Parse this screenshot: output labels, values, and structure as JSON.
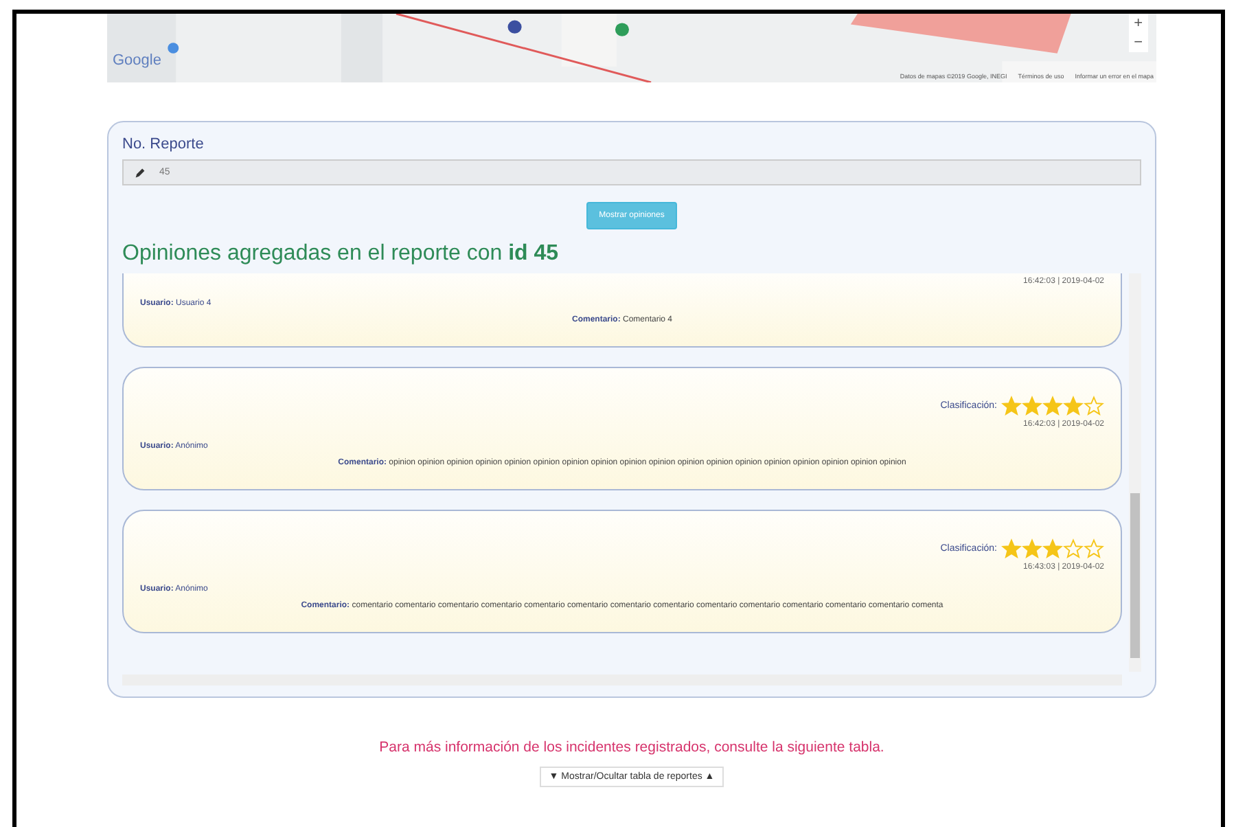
{
  "map": {
    "logo": "Google",
    "zoom_in": "+",
    "zoom_out": "−",
    "attribution": [
      "Datos de mapas ©2019 Google, INEGI",
      "Términos de uso",
      "Informar un error en el mapa"
    ]
  },
  "report": {
    "label": "No. Reporte",
    "value": "45",
    "button": "Mostrar opiniones"
  },
  "heading": "Opiniones agregadas en el reporte con **id 45**",
  "opinions": [
    {
      "time": "16:42:03 | 2019-04-02",
      "user_label": "Usuario:",
      "user": "Usuario 4",
      "comment_label": "Comentario:",
      "comment": "Comentario 4"
    },
    {
      "rating_label": "Clasificación:",
      "stars": 4,
      "time": "16:42:03 | 2019-04-02",
      "user_label": "Usuario:",
      "user": "Anónimo",
      "comment_label": "Comentario:",
      "comment": "opinion opinion opinion opinion opinion opinion opinion opinion opinion opinion opinion opinion opinion opinion opinion opinion opinion opinion"
    },
    {
      "rating_label": "Clasificación:",
      "stars": 3,
      "time": "16:43:03 | 2019-04-02",
      "user_label": "Usuario:",
      "user": "Anónimo",
      "comment_label": "Comentario:",
      "comment": "comentario comentario comentario comentario comentario comentario comentario comentario comentario comentario comentario comentario comentario comenta"
    }
  ],
  "info": "Para más información de los incidentes registrados, consulte la siguiente tabla.",
  "toggle": {
    "down": "▼",
    "label": "Mostrar/Ocultar tabla de reportes",
    "up": "▲"
  }
}
